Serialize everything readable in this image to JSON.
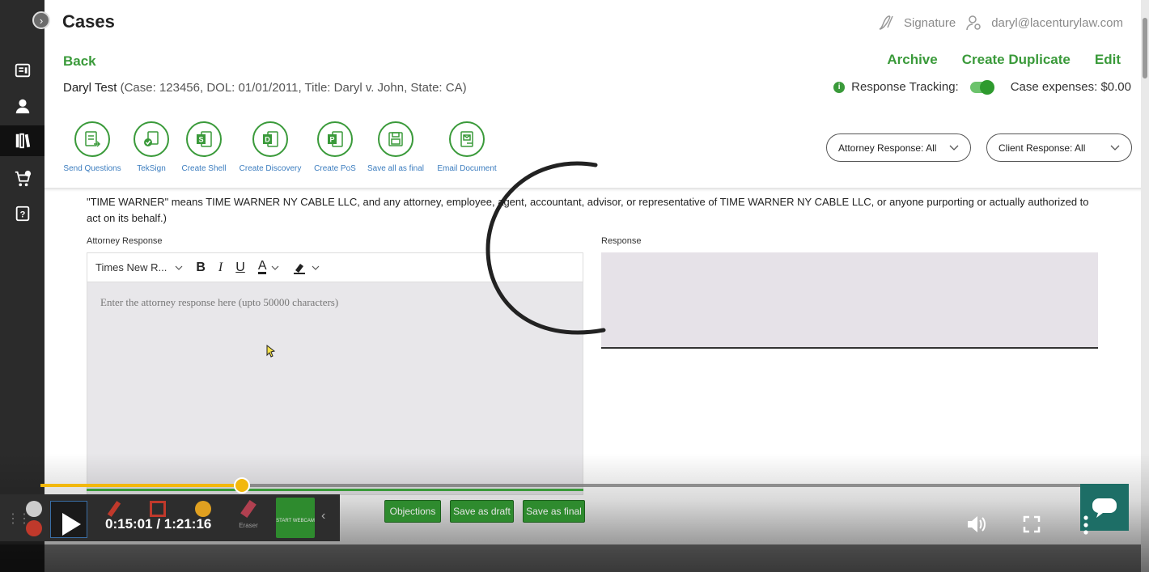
{
  "app": {
    "page_title": "Cases",
    "header": {
      "signature_label": "Signature",
      "user_email": "daryl@lacenturylaw.com"
    }
  },
  "case": {
    "back_label": "Back",
    "actions": {
      "archive": "Archive",
      "create_duplicate": "Create Duplicate",
      "edit": "Edit"
    },
    "name": "Daryl Test",
    "detail": "(Case: 123456, DOL: 01/01/2011, Title: Daryl v. John, State: CA)",
    "response_tracking_label": "Response Tracking:",
    "response_tracking_on": true,
    "case_expenses": "Case expenses: $0.00"
  },
  "toolbar": {
    "send_questions": "Send Questions",
    "teksign": "TekSign",
    "create_shell": "Create Shell",
    "create_discovery": "Create Discovery",
    "create_pos": "Create PoS",
    "save_all_final": "Save all as final",
    "email_document": "Email Document"
  },
  "filters": {
    "attorney": "Attorney Response: All",
    "client": "Client Response: All"
  },
  "definition_text": "\"TIME WARNER\" means TIME WARNER NY CABLE LLC, and any attorney, employee, agent, accountant, advisor, or representative of TIME WARNER NY CABLE LLC, or anyone purporting or actually authorized to act on its behalf.)",
  "editor": {
    "attorney_label": "Attorney Response",
    "font_select": "Times New R...",
    "placeholder": "Enter the attorney response here (upto 50000 characters)",
    "response_label": "Response"
  },
  "recorder": {
    "tools": [
      "Eraser"
    ],
    "webcam_label": "START WEBCAM"
  },
  "buttons": {
    "objections": "Objections",
    "save_draft": "Save as draft",
    "save_final": "Save as final"
  },
  "player": {
    "current_time": "0:15:01",
    "duration": "1:21:16",
    "time_display": "0:15:01 / 1:21:16",
    "progress": 0.189
  },
  "colors": {
    "brand_green": "#3a9a3a",
    "link_blue": "#3c7dbf",
    "progress_yellow": "#f2b80c",
    "sidebar": "#2b2b2b"
  }
}
